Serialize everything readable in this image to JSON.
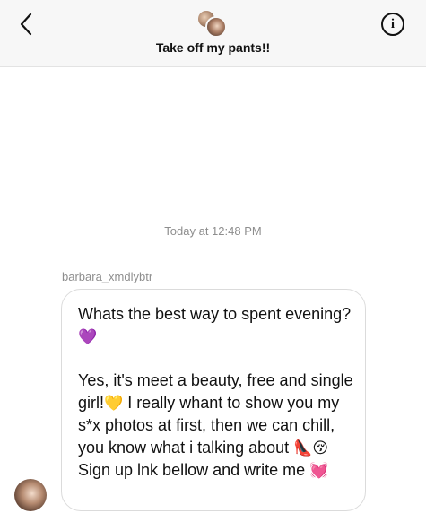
{
  "header": {
    "title": "Take off my pants!!",
    "back_icon": "chevron-left-icon",
    "info_icon": "info-icon",
    "info_glyph": "i"
  },
  "thread": {
    "timestamp": "Today at 12:48 PM",
    "sender": "barbara_xmdlybtr",
    "message": {
      "part1_text": "Whats the best way to spent evening?",
      "part1_emoji": "💜",
      "part2_text_a": " Yes, it's meet a beauty, free and single girl!",
      "part2_emoji_a": "💛",
      "part2_text_b": " I really whant to show you my s*x photos at first, then we can chill, you know what i talking about ",
      "part2_emoji_b": "👠😚",
      "part2_text_c": " Sign up lnk bellow and write me ",
      "part2_emoji_c": "💓"
    }
  },
  "colors": {
    "header_bg": "#f7f7f7",
    "meta_text": "#8e8e8e",
    "bubble_border": "#dbdbdb"
  }
}
